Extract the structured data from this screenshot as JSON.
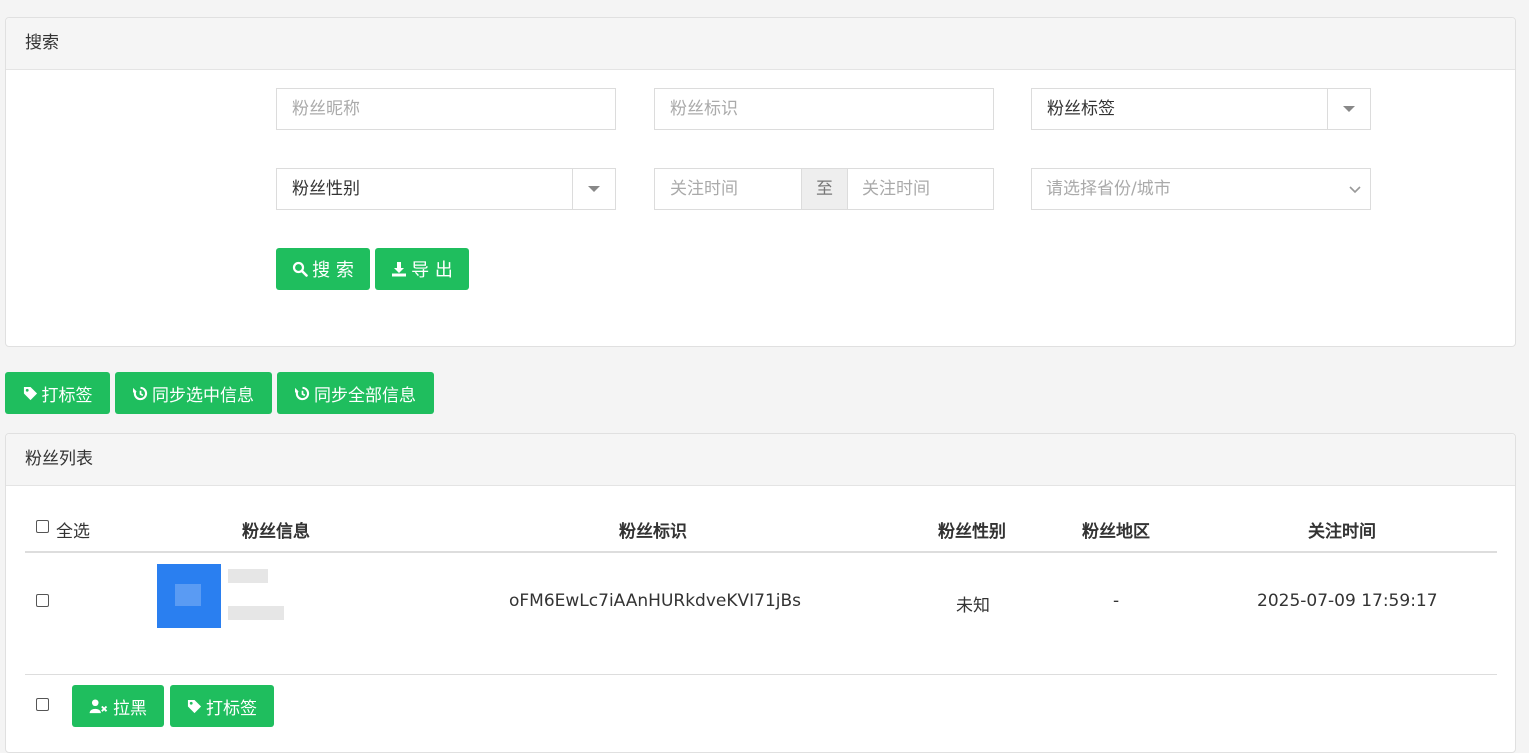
{
  "search": {
    "title": "搜索",
    "nickname_placeholder": "粉丝昵称",
    "openid_placeholder": "粉丝标识",
    "tag_select": "粉丝标签",
    "gender_select": "粉丝性别",
    "follow_start_placeholder": "关注时间",
    "range_sep": "至",
    "follow_end_placeholder": "关注时间",
    "region_placeholder": "请选择省份/城市",
    "search_button": "搜 索",
    "export_button": "导 出"
  },
  "toolbar": {
    "tag_button": "打标签",
    "sync_selected_button": "同步选中信息",
    "sync_all_button": "同步全部信息"
  },
  "list": {
    "title": "粉丝列表",
    "select_all_label": "全选",
    "columns": [
      "粉丝信息",
      "粉丝标识",
      "粉丝性别",
      "粉丝地区",
      "关注时间"
    ],
    "rows": [
      {
        "openid": "oFM6EwLc7iAAnHURkdveKVI71jBs",
        "gender": "未知",
        "region": "-",
        "follow_time": "2025-07-09 17:59:17"
      }
    ],
    "blacklist_button": "拉黑",
    "tag_button": "打标签"
  },
  "colors": {
    "primary": "#1fbe5e",
    "avatar": "#2a7ff0"
  }
}
